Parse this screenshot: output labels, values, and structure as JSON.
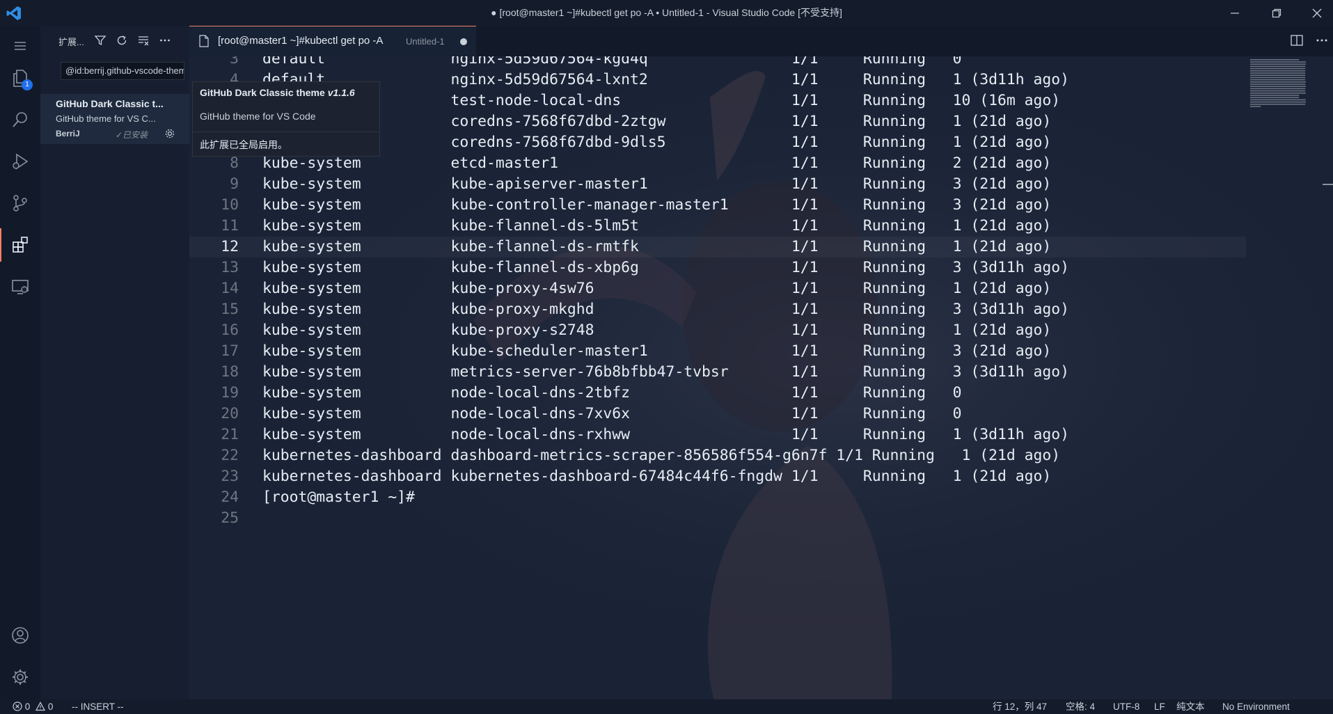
{
  "window": {
    "title": "● [root@master1 ~]#kubectl get po -A • Untitled-1 - Visual Studio Code [不受支持]",
    "app_icon": "vscode-logo",
    "controls": [
      "minimize-icon",
      "restore-icon",
      "close-icon"
    ]
  },
  "activity_bar": {
    "explorer_badge": "1",
    "items": [
      "menu-icon",
      "files-icon",
      "search-icon",
      "run-debug-icon",
      "source-control-icon",
      "extensions-icon",
      "remote-explorer-icon",
      "accounts-icon",
      "manage-gear-icon"
    ]
  },
  "sidebar": {
    "title": "扩展...",
    "search_value": "@id:berrij.github-vscode-theme",
    "extension": {
      "name": "GitHub Dark Classic t...",
      "description": "GitHub theme for VS C...",
      "publisher": "BerriJ",
      "installed": "✓已安装"
    }
  },
  "hover": {
    "title": "GitHub Dark Classic theme",
    "version": "v1.1.6",
    "description": "GitHub theme for VS Code",
    "status": "此扩展已全局启用。"
  },
  "tab": {
    "title": "[root@master1 ~]#kubectl get po -A",
    "description": "Untitled-1"
  },
  "editor": {
    "current_line": 12,
    "first_visible_line": 3,
    "lines": [
      "default              nginx-5d59d67564-kgd4q                1/1     Running   0",
      "default              nginx-5d59d67564-lxnt2                1/1     Running   1 (3d11h ago)",
      "default              test-node-local-dns                   1/1     Running   10 (16m ago)",
      "kube-system          coredns-7568f67dbd-2ztgw              1/1     Running   1 (21d ago)",
      "kube-system          coredns-7568f67dbd-9dls5              1/1     Running   1 (21d ago)",
      "kube-system          etcd-master1                          1/1     Running   2 (21d ago)",
      "kube-system          kube-apiserver-master1                1/1     Running   3 (21d ago)",
      "kube-system          kube-controller-manager-master1       1/1     Running   3 (21d ago)",
      "kube-system          kube-flannel-ds-5lm5t                 1/1     Running   1 (21d ago)",
      "kube-system          kube-flannel-ds-rmtfk                 1/1     Running   1 (21d ago)",
      "kube-system          kube-flannel-ds-xbp6g                 1/1     Running   3 (3d11h ago)",
      "kube-system          kube-proxy-4sw76                      1/1     Running   1 (21d ago)",
      "kube-system          kube-proxy-mkghd                      1/1     Running   3 (3d11h ago)",
      "kube-system          kube-proxy-s2748                      1/1     Running   1 (21d ago)",
      "kube-system          kube-scheduler-master1                1/1     Running   3 (21d ago)",
      "kube-system          metrics-server-76b8bfbb47-tvbsr       1/1     Running   3 (3d11h ago)",
      "kube-system          node-local-dns-2tbfz                  1/1     Running   0",
      "kube-system          node-local-dns-7xv6x                  1/1     Running   0",
      "kube-system          node-local-dns-rxhww                  1/1     Running   1 (3d11h ago)",
      "kubernetes-dashboard dashboard-metrics-scraper-856586f554-g6n7f 1/1 Running   1 (21d ago)",
      "kubernetes-dashboard kubernetes-dashboard-67484c44f6-fngdw 1/1     Running   1 (21d ago)",
      "[root@master1 ~]#",
      ""
    ]
  },
  "statusbar": {
    "errors": "0",
    "warnings": "0",
    "mode": "-- INSERT --",
    "position": "行 12，列 47",
    "indent": "空格: 4",
    "encoding": "UTF-8",
    "eol": "LF",
    "language": "纯文本",
    "environment": "No Environment"
  },
  "colors": {
    "accent": "#f78166",
    "badge": "#1f6feb",
    "background": "#1a2336"
  }
}
